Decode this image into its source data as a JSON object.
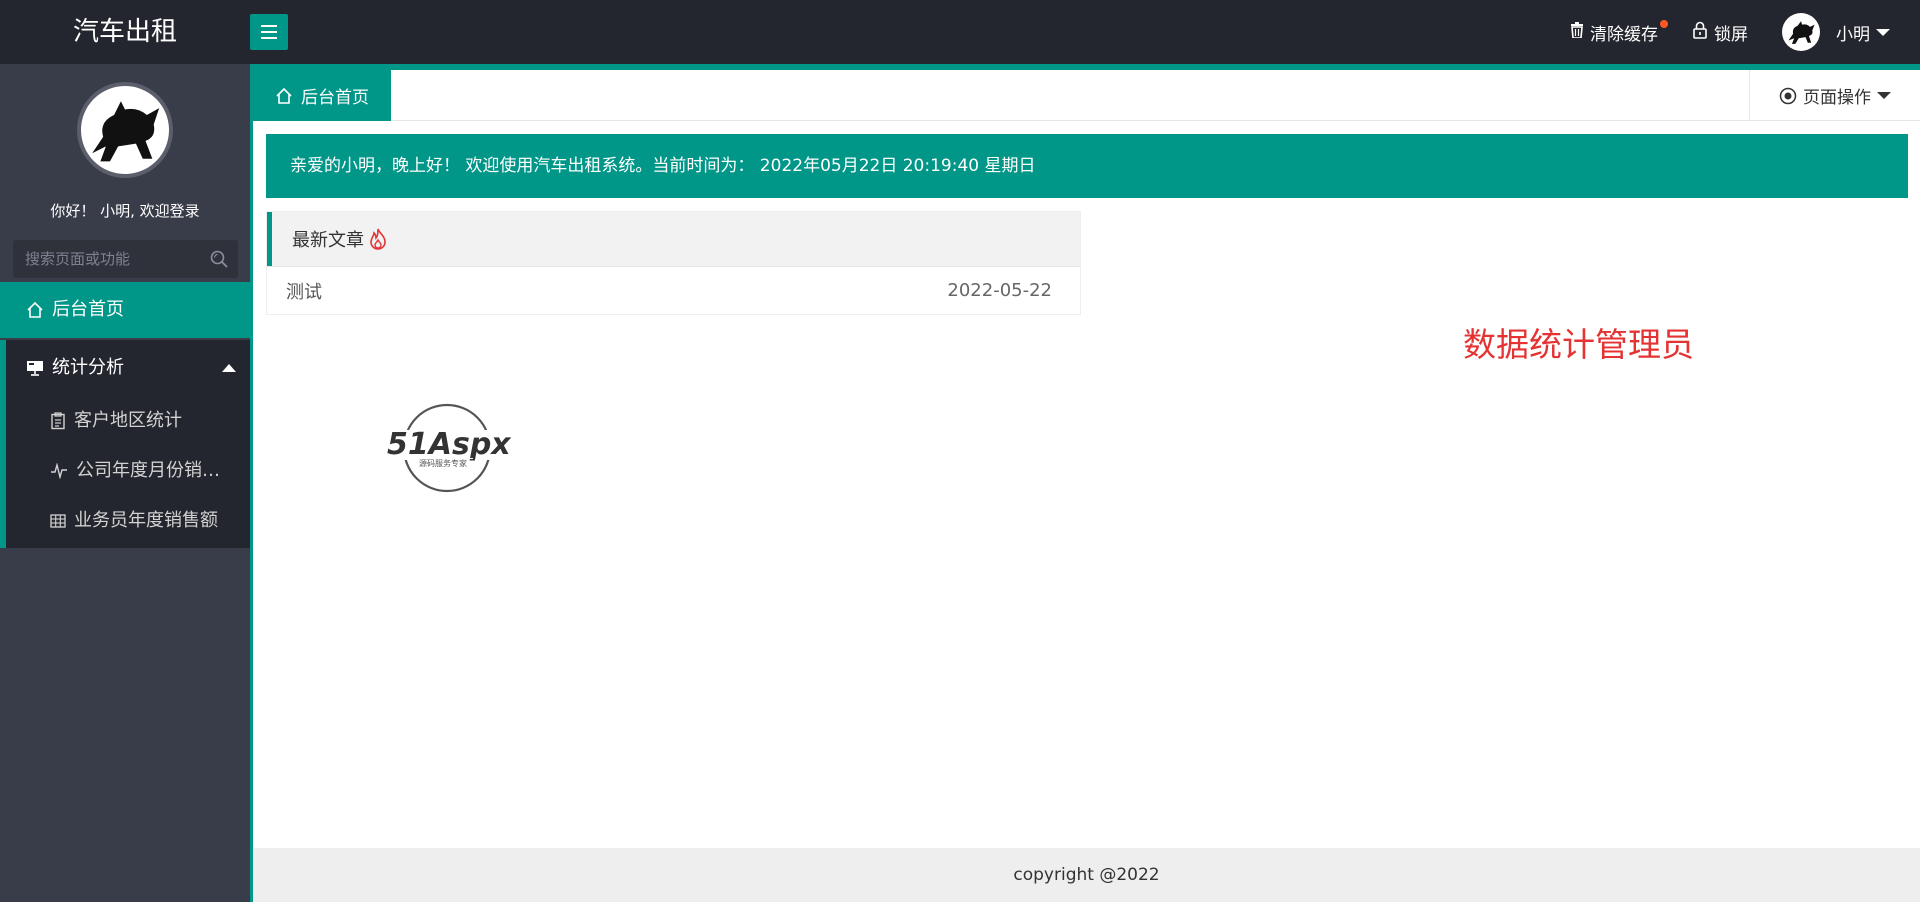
{
  "app": {
    "logo_text": "汽车出租"
  },
  "header": {
    "clear_cache_label": "清除缓存",
    "lock_screen_label": "锁屏",
    "user_name": "小明",
    "accent_color": "#009688",
    "dark_bg": "#23262e"
  },
  "sidebar": {
    "welcome_text": "你好！ 小明, 欢迎登录",
    "search_placeholder": "搜索页面或功能",
    "nav_home": "后台首页",
    "nav_stats": "统计分析",
    "sub_items": [
      {
        "label": "客户地区统计",
        "icon": "clipboard-icon"
      },
      {
        "label": "公司年度月份销售额",
        "icon": "pulse-icon"
      },
      {
        "label": "业务员年度销售额",
        "icon": "table-icon"
      }
    ]
  },
  "tabs": {
    "active_label": "后台首页",
    "page_ops_label": "页面操作"
  },
  "greeting": {
    "text": "亲爱的小明，晚上好！ 欢迎使用汽车出租系统。当前时间为： 2022年05月22日 20:19:40   星期日"
  },
  "articles": {
    "title": "最新文章",
    "items": [
      {
        "title": "测试",
        "date": "2022-05-22"
      }
    ]
  },
  "stats_title": "数据统计管理员",
  "brand": {
    "name": "51Aspx",
    "tagline": "源码服务专家"
  },
  "footer": {
    "copyright": "copyright @2022"
  }
}
